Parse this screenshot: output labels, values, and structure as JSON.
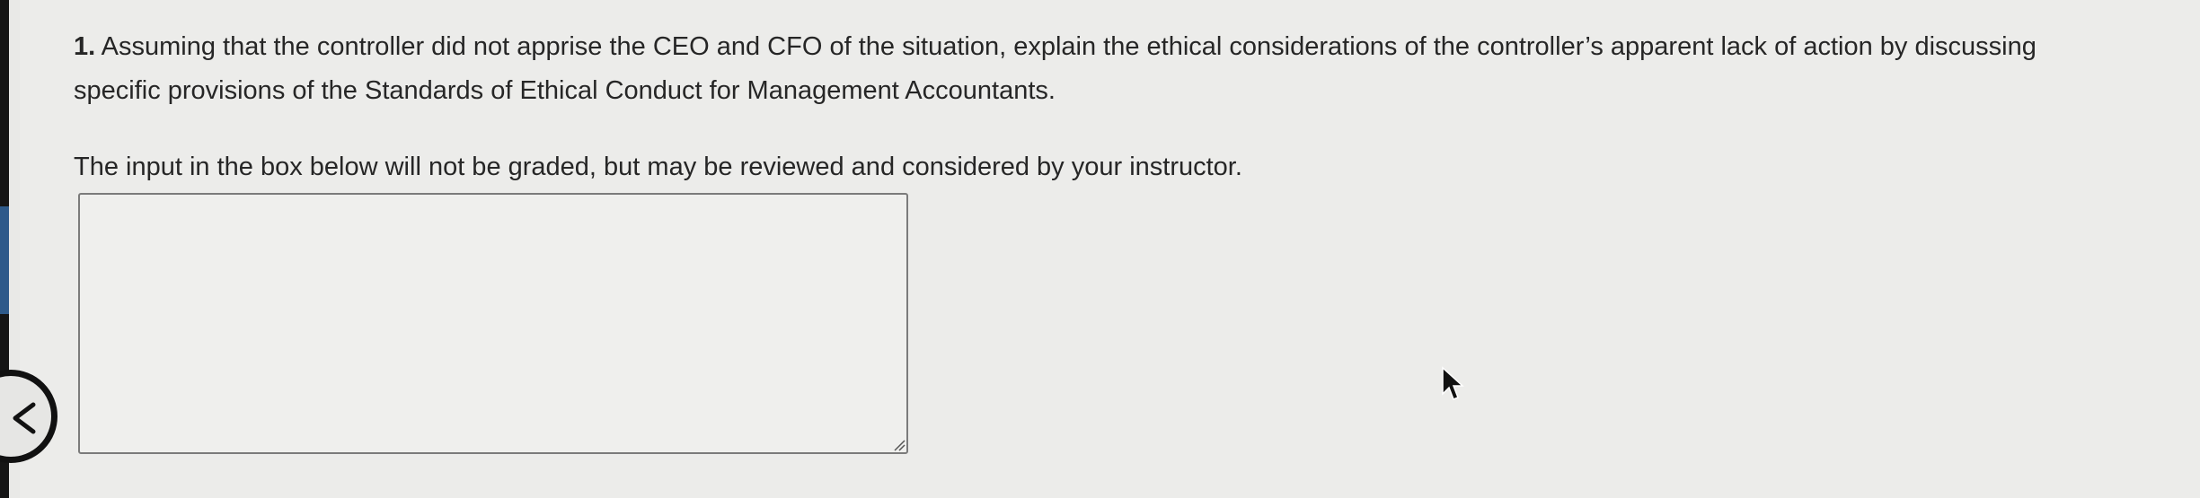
{
  "question": {
    "number": "1.",
    "line1": "Assuming that the controller did not apprise the CEO and CFO of the situation, explain the ethical considerations of the controller’s apparent lack of action by discussing",
    "line2": "specific provisions of the Standards of Ethical Conduct for Management Accountants."
  },
  "instruction": "The input in the box below will not be graded, but may be reviewed and considered by your instructor.",
  "answer_box": {
    "value": "",
    "placeholder": ""
  },
  "icons": {
    "back": "chevron-left-icon",
    "cursor": "mouse-pointer-icon",
    "grip": "resize-grip-icon"
  },
  "colors": {
    "page_background": "#ececea",
    "text": "#262626",
    "box_border": "#7b7b7b",
    "edge": "#151515"
  }
}
